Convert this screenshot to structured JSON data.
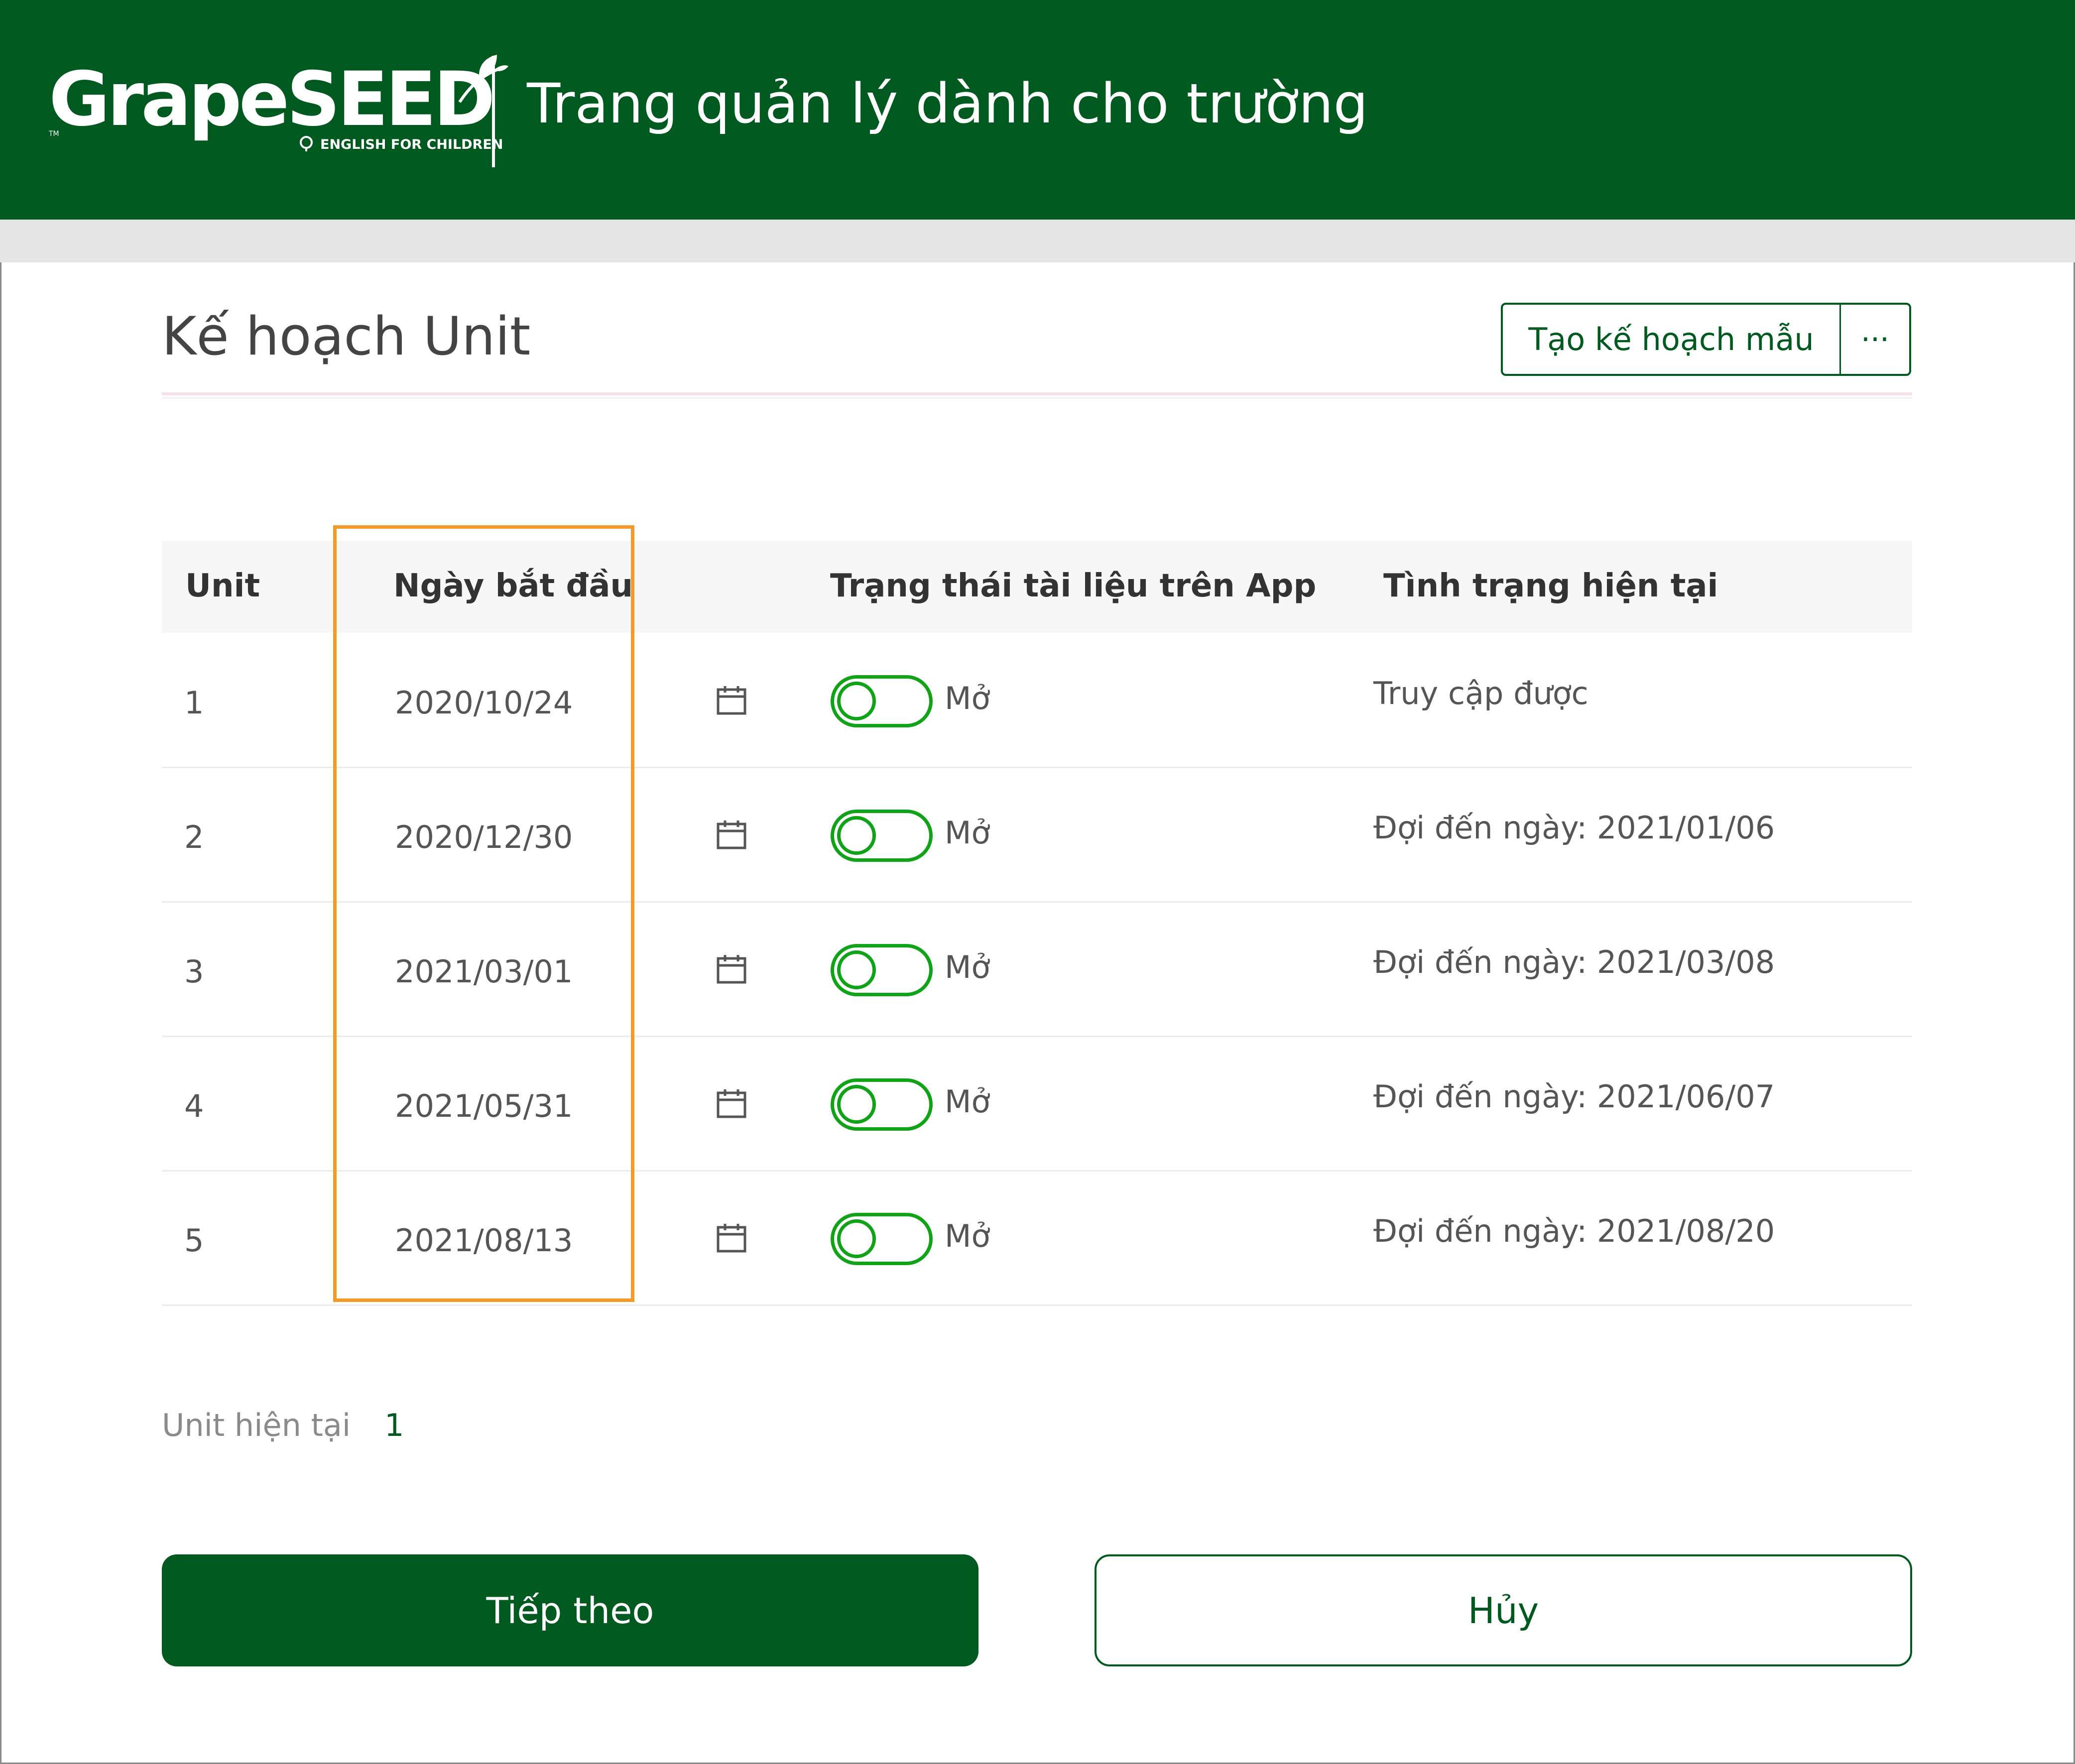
{
  "header": {
    "brand": "GrapeSEED",
    "brand_tagline": "ENGLISH FOR CHILDREN",
    "brand_tm": "TM",
    "title": "Trang quản lý dành cho trường"
  },
  "page": {
    "title": "Kế hoạch Unit",
    "create_template_label": "Tạo kế hoạch mẫu",
    "more_label": "···"
  },
  "table": {
    "columns": [
      "Unit",
      "Ngày bắt đầu",
      "Trạng thái tài liệu trên App",
      "Tình trạng hiện tại"
    ],
    "rows": [
      {
        "unit": "1",
        "start_date": "2020/10/24",
        "app_status": "Mở",
        "current_status": "Truy cập được"
      },
      {
        "unit": "2",
        "start_date": "2020/12/30",
        "app_status": "Mở",
        "current_status": "Đợi đến ngày: 2021/01/06"
      },
      {
        "unit": "3",
        "start_date": "2021/03/01",
        "app_status": "Mở",
        "current_status": "Đợi đến ngày: 2021/03/08"
      },
      {
        "unit": "4",
        "start_date": "2021/05/31",
        "app_status": "Mở",
        "current_status": "Đợi đến ngày: 2021/06/07"
      },
      {
        "unit": "5",
        "start_date": "2021/08/13",
        "app_status": "Mở",
        "current_status": "Đợi đến ngày: 2021/08/20"
      }
    ]
  },
  "current_unit": {
    "label": "Unit hiện tại",
    "value": "1"
  },
  "actions": {
    "next_label": "Tiếp theo",
    "cancel_label": "Hủy"
  },
  "colors": {
    "brand_green": "#005a1f",
    "toggle_green": "#10a318",
    "highlight_orange": "#f39a2b"
  },
  "icons": {
    "calendar": "calendar-icon",
    "leaf": "leaf-icon"
  }
}
